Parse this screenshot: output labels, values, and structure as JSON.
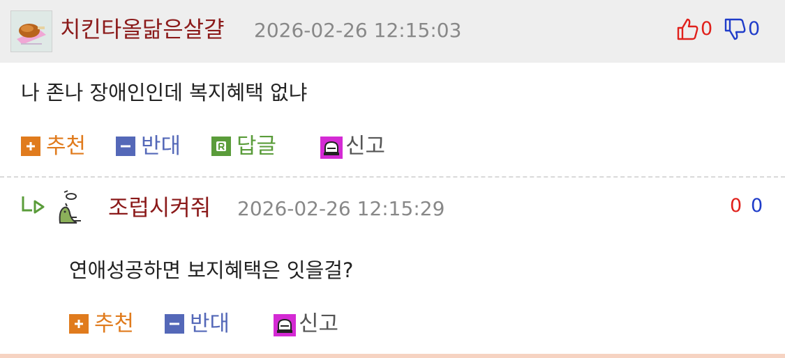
{
  "comments": [
    {
      "nickname": "치킨타올닮은살걀",
      "date": "2026-02-26 12:15:03",
      "up_count": "0",
      "down_count": "0",
      "content": "나 존나 장애인인데 복지혜택 없냐",
      "actions": {
        "recommend": "추천",
        "oppose": "반대",
        "reply": "답글",
        "report": "신고"
      }
    },
    {
      "nickname": "조럽시켜줘",
      "date": "2026-02-26 12:15:29",
      "up_count": "0",
      "down_count": "0",
      "content": "연애성공하면 보지혜택은 잇을걸?",
      "actions": {
        "recommend": "추천",
        "oppose": "반대",
        "report": "신고"
      }
    }
  ],
  "colors": {
    "nickname": "#8b1a1a",
    "up": "#e0201b",
    "down": "#1f3cc9",
    "recommend": "#e07b1d",
    "oppose": "#5468b8",
    "reply": "#5a9c3a",
    "report_icon": "#d42ad4"
  },
  "icons": [
    "avatar-chicken",
    "thumbs-up-icon",
    "thumbs-down-icon",
    "plus-icon",
    "minus-icon",
    "reply-r-icon",
    "siren-icon",
    "reply-arrow-icon",
    "avatar-figure"
  ]
}
